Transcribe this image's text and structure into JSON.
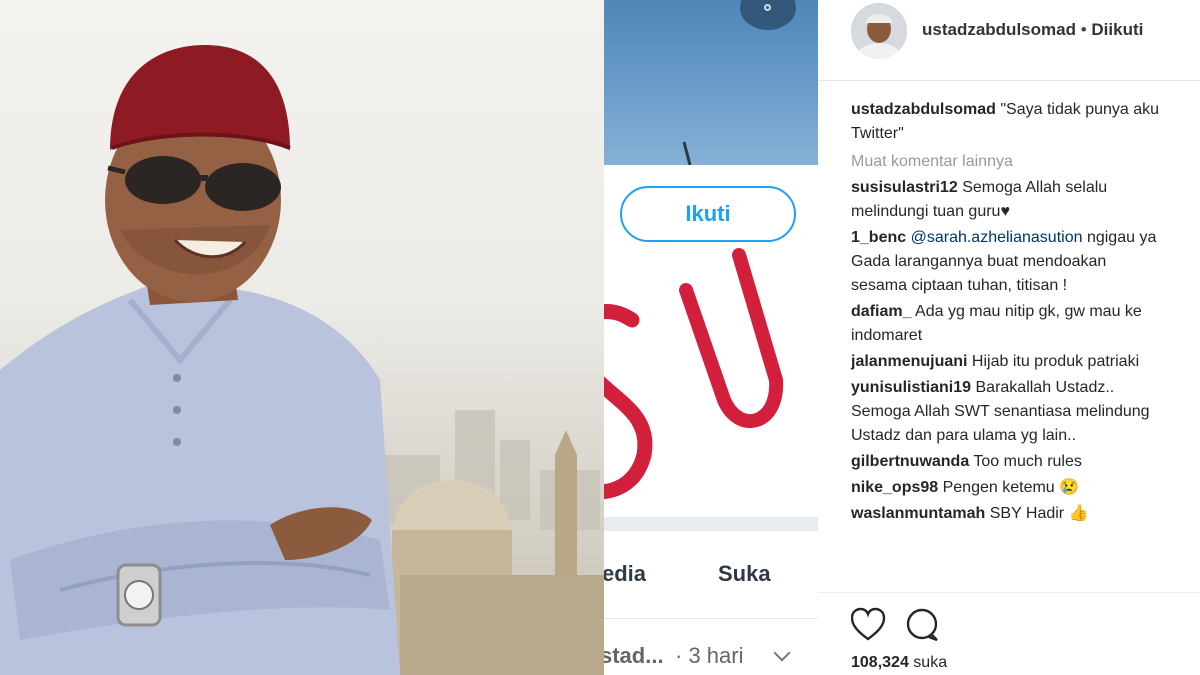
{
  "twitter": {
    "follow_label": "Ikuti",
    "tabs": [
      {
        "label": "edia"
      },
      {
        "label": "Suka"
      }
    ],
    "tweet_user": "stad...",
    "tweet_time": "· 3 hari"
  },
  "instagram": {
    "username": "ustadzabdulsomad",
    "follow_state": "Diikuti",
    "caption_user": "ustadzabdulsomad",
    "caption_lines": [
      "\"Saya tidak punya aku",
      "Twitter\""
    ],
    "load_more": "Muat komentar lainnya",
    "comments": [
      {
        "user": "susisulastri12",
        "lines": [
          "Semoga Allah selalu",
          "melindungi tuan guru♥"
        ]
      },
      {
        "user": "1_benc",
        "mention": "@sarah.azhelianasution",
        "lines": [
          "ngigau ya",
          "Gada larangannya buat mendoakan",
          "sesama ciptaan tuhan, titisan !"
        ]
      },
      {
        "user": "dafiam_",
        "lines": [
          "Ada yg mau nitip gk, gw mau ke",
          "indomaret"
        ]
      },
      {
        "user": "jalanmenujuani",
        "lines": [
          "Hijab itu produk patriaki"
        ]
      },
      {
        "user": "yunisulistiani19",
        "lines": [
          "Barakallah Ustadz..",
          "Semoga Allah SWT senantiasa melindung",
          "Ustadz dan para ulama yg lain.."
        ]
      },
      {
        "user": "gilbertnuwanda",
        "lines": [
          "Too much rules"
        ]
      },
      {
        "user": "nike_ops98",
        "lines": [
          "Pengen ketemu 😢"
        ]
      },
      {
        "user": "waslanmuntamah",
        "lines": [
          "SBY Hadir 👍"
        ]
      }
    ],
    "likes_count": "108,324",
    "likes_unit": "suka",
    "icons": [
      "heart-icon",
      "comment-icon"
    ]
  },
  "colors": {
    "twitter_blue": "#1da1f2",
    "logo_red": "#d21f3c",
    "cap_red": "#8e1b24"
  }
}
